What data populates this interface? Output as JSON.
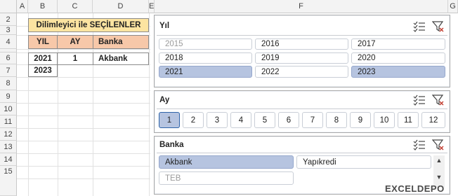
{
  "spreadsheet": {
    "columns": [
      "A",
      "B",
      "C",
      "D",
      "E",
      "F",
      "G"
    ],
    "rows": [
      "2",
      "3",
      "4",
      "5",
      "6",
      "7",
      "8",
      "9",
      "10",
      "11",
      "12",
      "13",
      "14",
      "15"
    ],
    "title": "Dilimleyici ile SEÇİLENLER",
    "headers": [
      "YIL",
      "AY",
      "Banka"
    ],
    "values": {
      "year1": "2021",
      "year2": "2023",
      "month": "1",
      "bank": "Akbank"
    },
    "colors": {
      "title_bg": "#fce4a1",
      "header_bg": "#f7c8a9"
    }
  },
  "slicers": {
    "year": {
      "title": "Yıl",
      "items": [
        "2015",
        "2016",
        "2017",
        "2018",
        "2019",
        "2020",
        "2021",
        "2022",
        "2023"
      ]
    },
    "month": {
      "title": "Ay",
      "items": [
        "1",
        "2",
        "3",
        "4",
        "5",
        "6",
        "7",
        "8",
        "9",
        "10",
        "11",
        "12"
      ]
    },
    "bank": {
      "title": "Banka",
      "items": [
        "Akbank",
        "Yapıkredi",
        "TEB"
      ]
    },
    "icons": {
      "multiselect": "multi-select-icon",
      "clear": "clear-filter-icon"
    },
    "colors": {
      "selected": "#b6c4e0",
      "selected_border": "#95a7cc"
    }
  },
  "watermark": "EXCELDEPO"
}
